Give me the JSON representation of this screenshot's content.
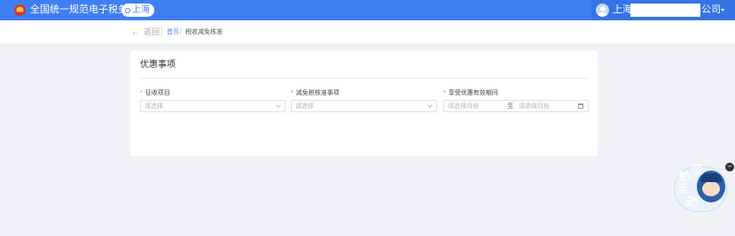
{
  "header": {
    "site_title": "全国统一规范电子税务局",
    "region": "上海",
    "user_city": "上海",
    "user_company": "公司"
  },
  "breadcrumb": {
    "back": "返回",
    "home": "首页",
    "separator": "/",
    "current": "税收减免核准"
  },
  "card": {
    "title": "优惠事项",
    "required_mark": "*",
    "fields": [
      {
        "label": "征收项目",
        "placeholder": "请选择"
      },
      {
        "label": "减免税核准事项",
        "placeholder": "请选择"
      },
      {
        "label": "享受优惠有效期间",
        "start_placeholder": "请选择月份",
        "range_separator": "至",
        "end_placeholder": "请选择月份"
      }
    ]
  },
  "mascot": {
    "chars": [
      "征",
      "纳",
      "互",
      "动"
    ],
    "close": "−"
  },
  "colors": {
    "brand": "#3f7ff3",
    "required": "#f56c6c"
  },
  "icons": {
    "emblem": "national-emblem-icon",
    "region": "location-pin-icon",
    "back": "arrow-left-icon",
    "select": "chevron-down-icon",
    "date": "calendar-icon"
  }
}
